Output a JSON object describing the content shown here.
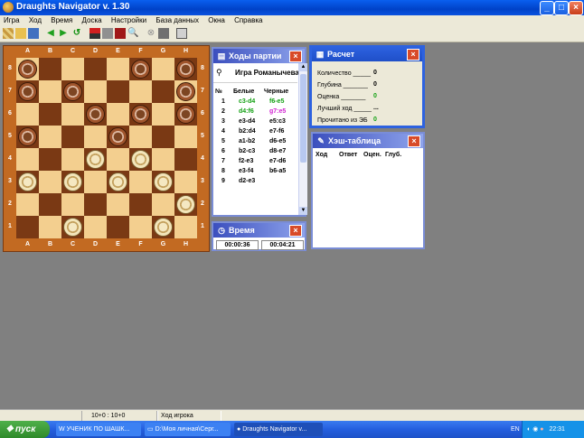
{
  "window": {
    "title": "Draughts Navigator v. 1.30"
  },
  "menu": [
    "Игра",
    "Ход",
    "Время",
    "Доска",
    "Настройки",
    "База данных",
    "Окна",
    "Справка"
  ],
  "toolbar_icons": [
    "new-game-icon",
    "open-icon",
    "save-icon",
    "back-icon",
    "forward-icon",
    "undo-icon",
    "flag-red-icon",
    "flag-gray-icon",
    "stop-icon",
    "search-icon",
    "cancel-icon",
    "settings-icon",
    "help-book-icon"
  ],
  "board": {
    "files": [
      "A",
      "B",
      "C",
      "D",
      "E",
      "F",
      "G",
      "H"
    ],
    "ranks": [
      "8",
      "7",
      "6",
      "5",
      "4",
      "3",
      "2",
      "1"
    ],
    "pieces": [
      {
        "square": "a8",
        "color": "brown"
      },
      {
        "square": "f8",
        "color": "brown"
      },
      {
        "square": "h8",
        "color": "brown"
      },
      {
        "square": "a7",
        "color": "brown"
      },
      {
        "square": "c7",
        "color": "brown"
      },
      {
        "square": "h7",
        "color": "brown"
      },
      {
        "square": "d6",
        "color": "brown"
      },
      {
        "square": "f6",
        "color": "brown"
      },
      {
        "square": "h6",
        "color": "brown"
      },
      {
        "square": "a5",
        "color": "brown"
      },
      {
        "square": "e5",
        "color": "brown"
      },
      {
        "square": "d4",
        "color": "white"
      },
      {
        "square": "f4",
        "color": "white"
      },
      {
        "square": "a3",
        "color": "white"
      },
      {
        "square": "c3",
        "color": "white"
      },
      {
        "square": "e3",
        "color": "white"
      },
      {
        "square": "g3",
        "color": "white"
      },
      {
        "square": "h2",
        "color": "white"
      },
      {
        "square": "c1",
        "color": "white"
      },
      {
        "square": "g1",
        "color": "white"
      }
    ]
  },
  "moves_panel": {
    "title": "Ходы партии",
    "game_title": "Игра Романычева",
    "col_no": "№",
    "col_white": "Белые",
    "col_black": "Черные",
    "rows": [
      {
        "n": "1",
        "w": "c3-d4",
        "b": "f6-e5",
        "wc": "#12a012",
        "bc": "#12a012"
      },
      {
        "n": "2",
        "w": "d4:f6",
        "b": "g7:e5",
        "wc": "#12a012",
        "bc": "#d020d0"
      },
      {
        "n": "3",
        "w": "e3-d4",
        "b": "e5:c3",
        "wc": "#000000",
        "bc": "#000000"
      },
      {
        "n": "4",
        "w": "b2:d4",
        "b": "e7-f6",
        "wc": "#000000",
        "bc": "#000000"
      },
      {
        "n": "5",
        "w": "a1-b2",
        "b": "d6-e5",
        "wc": "#000000",
        "bc": "#000000"
      },
      {
        "n": "6",
        "w": "b2-c3",
        "b": "d8-e7",
        "wc": "#000000",
        "bc": "#000000"
      },
      {
        "n": "7",
        "w": "f2-e3",
        "b": "e7-d6",
        "wc": "#000000",
        "bc": "#000000"
      },
      {
        "n": "8",
        "w": "e3-f4",
        "b": "b6-a5",
        "wc": "#000000",
        "bc": "#000000"
      },
      {
        "n": "9",
        "w": "d2-e3",
        "b": "",
        "wc": "#000000",
        "bc": "#000000"
      }
    ]
  },
  "calc_panel": {
    "title": "Расчет",
    "rows": [
      {
        "label": "Количество _____",
        "value": "0",
        "color": "#000000"
      },
      {
        "label": "Глубина _______",
        "value": "0",
        "color": "#000000"
      },
      {
        "label": "Оценка _______",
        "value": "0",
        "color": "#12a012"
      },
      {
        "label": "Лучший ход _____",
        "value": "...",
        "color": "#000000"
      },
      {
        "label": "Прочитано из ЭБ",
        "value": "0",
        "color": "#12a012"
      }
    ]
  },
  "hash_panel": {
    "title": "Хэш-таблица",
    "cols": [
      "Ход",
      "Ответ",
      "Оцен.",
      "Глуб."
    ]
  },
  "time_panel": {
    "title": "Время",
    "white_time": "00:00:36",
    "black_time": "00:04:21"
  },
  "status": {
    "score": "10+0 : 10+0",
    "turn": "Ход игрока"
  },
  "taskbar": {
    "start": "пуск",
    "tasks": [
      "УЧЕНИК ПО ШАШК...",
      "D:\\Моя личная\\Серг...",
      "Draughts Navigator v..."
    ],
    "lang": "EN",
    "clock": "22:31"
  }
}
